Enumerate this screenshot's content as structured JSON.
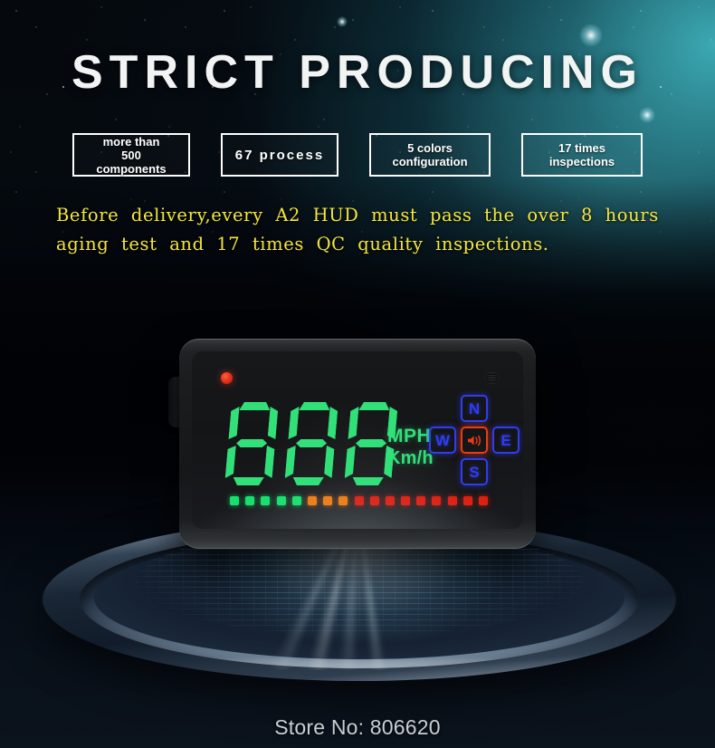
{
  "header": {
    "title": "STRICT PRODUCING"
  },
  "badges": [
    {
      "id": "more-than-500-components",
      "text": "more than\n500 components"
    },
    {
      "id": "67-process",
      "text": "67 process"
    },
    {
      "id": "5-colors-configuration",
      "text": "5 colors\nconfiguration"
    },
    {
      "id": "17-times-inspections",
      "text": "17 times\ninspections"
    }
  ],
  "description": {
    "line1": "Before  delivery,every  A2  HUD  must  pass  the  over  8  hours",
    "line2": "aging  test  and  17  times  QC  quality  inspections."
  },
  "device": {
    "name": "A2 HUD head-up display",
    "display": {
      "digits": "888",
      "unit_primary": "MPH",
      "unit_secondary": "Km/h",
      "compass": {
        "north": "N",
        "west": "W",
        "east": "E",
        "south": "S",
        "center_icon": "speaker-icon"
      },
      "led_bar": {
        "total": 17,
        "green": 5,
        "orange": 3,
        "red": 9
      },
      "indicator_led": "power-led",
      "sensor": "light-sensor"
    }
  },
  "footer": {
    "store_no": "Store No: 806620"
  },
  "colors": {
    "headline": "#f2f4f4",
    "badge_border": "#ffffff",
    "description": "#f5e63c",
    "digit_green": "#32e07a",
    "compass_blue": "#2f3df0",
    "speaker_red": "#ef3a14",
    "led_green": "#14e06b",
    "led_orange": "#f07a10",
    "led_red": "#de1f10",
    "nebula_teal": "#3eb0ba",
    "footer_text": "#c9ced4"
  }
}
